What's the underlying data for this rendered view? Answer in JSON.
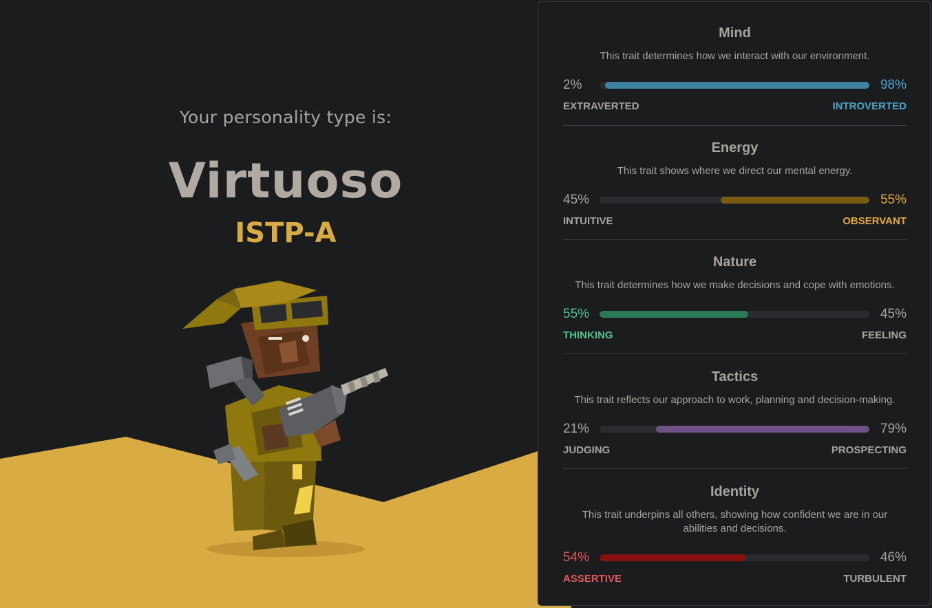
{
  "hero": {
    "intro": "Your personality type is:",
    "type_name": "Virtuoso",
    "type_code": "ISTP-A",
    "illustration_icon": "virtuoso-character-illustration",
    "ground_color": "#d9ac43"
  },
  "traits": [
    {
      "title": "Mind",
      "description": "This trait determines how we interact with our environment.",
      "left_pct": "2%",
      "right_pct": "98%",
      "left_label": "EXTRAVERTED",
      "right_label": "INTROVERTED",
      "dominant": "right",
      "value": 98,
      "color": "#3e829f",
      "label_color": "#4fa3c7"
    },
    {
      "title": "Energy",
      "description": "This trait shows where we direct our mental energy.",
      "left_pct": "45%",
      "right_pct": "55%",
      "left_label": "INTUITIVE",
      "right_label": "OBSERVANT",
      "dominant": "right",
      "value": 55,
      "color": "#7a5b14",
      "label_color": "#e2a93b"
    },
    {
      "title": "Nature",
      "description": "This trait determines how we make decisions and cope with emotions.",
      "left_pct": "55%",
      "right_pct": "45%",
      "left_label": "THINKING",
      "right_label": "FEELING",
      "dominant": "left",
      "value": 55,
      "color": "#2a7a58",
      "label_color": "#4fc292"
    },
    {
      "title": "Tactics",
      "description": "This trait reflects our approach to work, planning and decision-making.",
      "left_pct": "21%",
      "right_pct": "79%",
      "left_label": "JUDGING",
      "right_label": "PROSPECTING",
      "dominant": "right",
      "value": 79,
      "color": "#6e5283",
      "label_color": "#a9a39d"
    },
    {
      "title": "Identity",
      "description": "This trait underpins all others, showing how confident we are in our abilities and decisions.",
      "left_pct": "54%",
      "right_pct": "46%",
      "left_label": "ASSERTIVE",
      "right_label": "TURBULENT",
      "dominant": "left",
      "value": 54,
      "color": "#8a0f0f",
      "label_color": "#e05858"
    }
  ]
}
